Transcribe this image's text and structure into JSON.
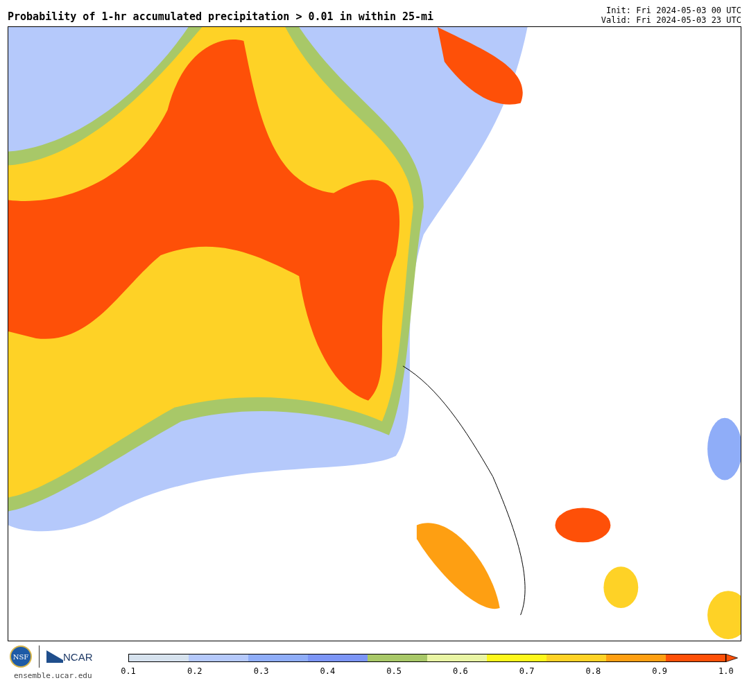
{
  "title": "Probability of 1-hr accumulated precipitation > 0.01 in within 25-mi",
  "init": "Init: Fri 2024-05-03 00 UTC",
  "valid": "Valid: Fri 2024-05-03 23 UTC",
  "logos": {
    "nsf": "NSF",
    "ncar": "NCAR",
    "url": "ensemble.ucar.edu"
  },
  "colorbar": {
    "segments": [
      {
        "color": "#d6e2ee"
      },
      {
        "color": "#b5c9fb"
      },
      {
        "color": "#8fadf8"
      },
      {
        "color": "#7c95f6"
      },
      {
        "color": "#a8c868"
      },
      {
        "color": "#e9f5a4"
      },
      {
        "color": "#fdf71c"
      },
      {
        "color": "#fed226"
      },
      {
        "color": "#fe9f12"
      },
      {
        "color": "#fe5008"
      }
    ],
    "labels": [
      "0.1",
      "0.2",
      "0.3",
      "0.4",
      "0.5",
      "0.6",
      "0.7",
      "0.8",
      "0.9",
      "1.0"
    ]
  }
}
